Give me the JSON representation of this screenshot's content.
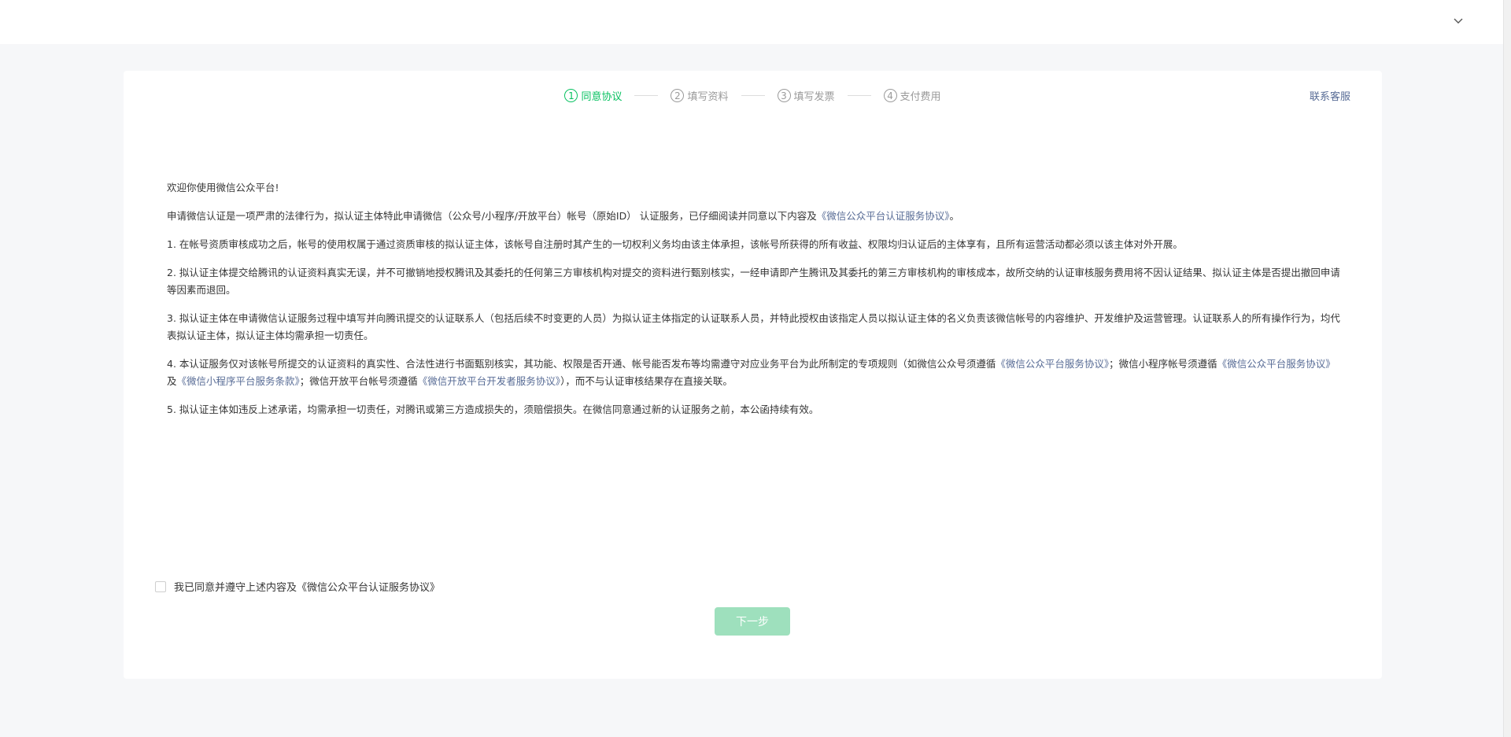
{
  "topbar": {
    "dropdown_icon": "chevron-down-icon"
  },
  "steps": [
    {
      "num": "1",
      "label": "同意协议",
      "active": true
    },
    {
      "num": "2",
      "label": "填写资料",
      "active": false
    },
    {
      "num": "3",
      "label": "填写发票",
      "active": false
    },
    {
      "num": "4",
      "label": "支付费用",
      "active": false
    }
  ],
  "contact_label": "联系客服",
  "content": {
    "welcome": "欢迎你使用微信公众平台!",
    "intro_text": "申请微信认证是一项严肃的法律行为，拟认证主体特此申请微信（公众号/小程序/开放平台）帐号（原始ID） 认证服务，已仔细阅读并同意以下内容及",
    "intro_link": "《微信公众平台认证服务协议》",
    "intro_end": "。",
    "p1": "1. 在帐号资质审核成功之后，帐号的使用权属于通过资质审核的拟认证主体，该帐号自注册时其产生的一切权利义务均由该主体承担，该帐号所获得的所有收益、权限均归认证后的主体享有，且所有运营活动都必须以该主体对外开展。",
    "p2": "2. 拟认证主体提交给腾讯的认证资料真实无误，并不可撤销地授权腾讯及其委托的任何第三方审核机构对提交的资料进行甄别核实，一经申请即产生腾讯及其委托的第三方审核机构的审核成本，故所交纳的认证审核服务费用将不因认证结果、拟认证主体是否提出撤回申请等因素而退回。",
    "p3": "3. 拟认证主体在申请微信认证服务过程中填写并向腾讯提交的认证联系人（包括后续不时变更的人员）为拟认证主体指定的认证联系人员，并特此授权由该指定人员以拟认证主体的名义负责该微信帐号的内容维护、开发维护及运营管理。认证联系人的所有操作行为，均代表拟认证主体，拟认证主体均需承担一切责任。",
    "p4_a": "4. 本认证服务仅对该帐号所提交的认证资料的真实性、合法性进行书面甄别核实，其功能、权限是否开通、帐号能否发布等均需遵守对应业务平台为此所制定的专项规则（如微信公众号须遵循",
    "p4_link1": "《微信公众平台服务协议》",
    "p4_b": "；微信小程序帐号须遵循",
    "p4_link2": "《微信公众平台服务协议》",
    "p4_c": "及",
    "p4_link3": "《微信小程序平台服务条款》",
    "p4_d": "；微信开放平台帐号须遵循",
    "p4_link4": "《微信开放平台开发者服务协议》",
    "p4_e": "），而不与认证审核结果存在直接关联。",
    "p5": "5. 拟认证主体如违反上述承诺，均需承担一切责任，对腾讯或第三方造成损失的，须赔偿损失。在微信同意通过新的认证服务之前，本公函持续有效。"
  },
  "agree_label": "我已同意并遵守上述内容及《微信公众平台认证服务协议》",
  "next_label": "下一步",
  "colors": {
    "accent": "#07c160",
    "link": "#576b95",
    "button_disabled": "#9ee0bd"
  }
}
